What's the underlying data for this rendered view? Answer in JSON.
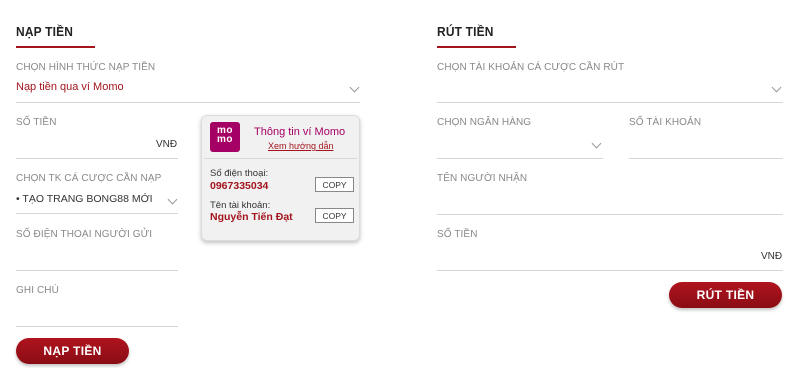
{
  "deposit": {
    "title": "NẠP TIỀN",
    "method_label": "CHỌN HÌNH THỨC NẠP TIỀN",
    "method_value": "Nạp tiền qua ví Momo",
    "amount_label": "SỐ TIỀN",
    "amount_unit": "VNĐ",
    "account_label": "CHỌN TK CÁ CƯỢC CẦN NẠP",
    "account_value": "• TẠO TRANG BONG88 MỚI",
    "sender_phone_label": "SỐ ĐIỆN THOẠI NGƯỜI GỬI",
    "note_label": "GHI CHÚ",
    "submit_label": "NẠP TIỀN"
  },
  "momo": {
    "logo_text_top": "mo",
    "logo_text_bottom": "mo",
    "title": "Thông tin ví Momo",
    "guide_link": "Xem hướng dẫn",
    "phone_label": "Số điện thoại:",
    "phone_value": "0967335034",
    "name_label": "Tên tài khoản:",
    "name_value": "Nguyễn Tiến Đạt",
    "copy_label": "COPY"
  },
  "withdraw": {
    "title": "RÚT TIỀN",
    "account_label": "CHỌN TÀI KHOẢN CÁ CƯỢC CẦN RÚT",
    "bank_label": "CHỌN NGÂN HÀNG",
    "account_number_label": "SỐ TÀI KHOẢN",
    "receiver_label": "TÊN NGƯỜI NHẬN",
    "amount_label": "SỐ TIỀN",
    "amount_unit": "VNĐ",
    "submit_label": "RÚT TIỀN"
  },
  "colors": {
    "accent": "#a3141d",
    "momo": "#a50064"
  }
}
